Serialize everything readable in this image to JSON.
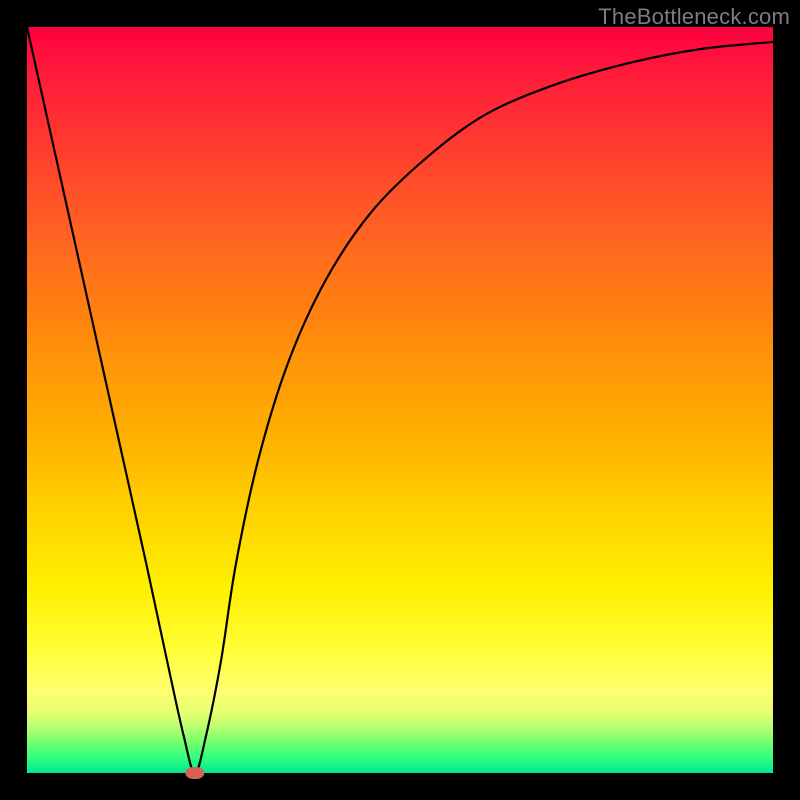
{
  "watermark": "TheBottleneck.com",
  "chart_data": {
    "type": "line",
    "title": "",
    "xlabel": "",
    "ylabel": "",
    "xlim": [
      0,
      100
    ],
    "ylim": [
      0,
      100
    ],
    "grid": false,
    "series": [
      {
        "name": "bottleneck-curve",
        "x": [
          0,
          4,
          8,
          12,
          16,
          19,
          21,
          22.5,
          24,
          26,
          28,
          31,
          35,
          40,
          46,
          53,
          61,
          70,
          80,
          90,
          100
        ],
        "y": [
          100,
          82,
          64,
          46,
          28,
          14,
          5,
          0,
          5,
          15,
          28,
          42,
          55,
          66,
          75,
          82,
          88,
          92,
          95,
          97,
          98
        ]
      }
    ],
    "marker": {
      "x": 22.5,
      "y": 0,
      "w_pct": 2.6,
      "h_pct": 1.6,
      "color": "#d8605b"
    },
    "background_gradient": {
      "top": "#ff0040",
      "mid": "#ffd200",
      "bottom": "#00e890"
    }
  }
}
